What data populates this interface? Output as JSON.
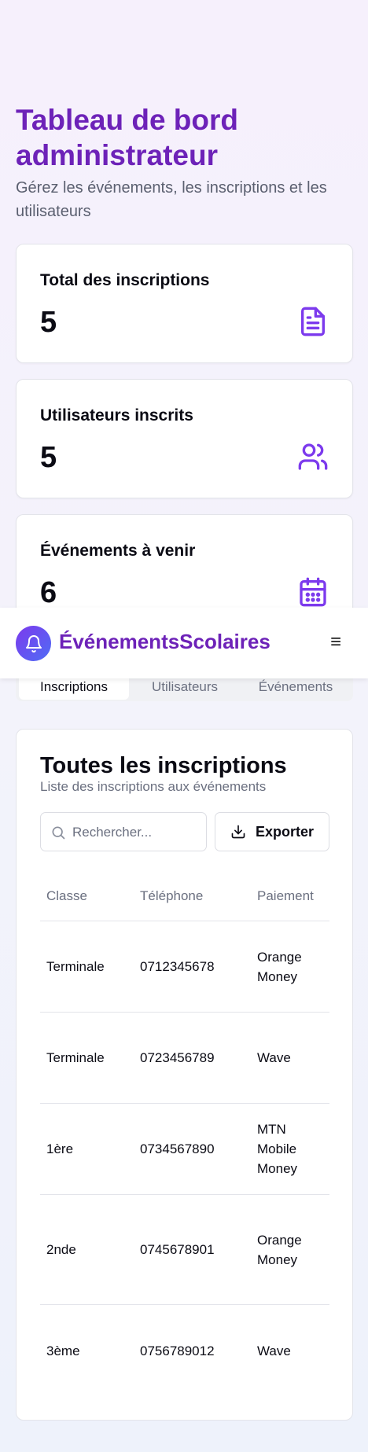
{
  "header": {
    "title": "Tableau de bord administrateur",
    "subtitle": "Gérez les événements, les inscriptions et les utilisateurs"
  },
  "stats": [
    {
      "label": "Total des inscriptions",
      "value": "5",
      "icon": "document-icon"
    },
    {
      "label": "Utilisateurs inscrits",
      "value": "5",
      "icon": "users-icon"
    },
    {
      "label": "Événements à venir",
      "value": "6",
      "icon": "calendar-icon"
    }
  ],
  "navbar": {
    "brand": "ÉvénementsScolaires",
    "logo_icon": "bell-icon",
    "menu_glyph": "≡"
  },
  "tabs": [
    {
      "label": "Inscriptions",
      "active": true
    },
    {
      "label": "Utilisateurs",
      "active": false
    },
    {
      "label": "Événements",
      "active": false
    }
  ],
  "inscriptions": {
    "title": "Toutes les inscriptions",
    "subtitle": "Liste des inscriptions aux événements",
    "search_placeholder": "Rechercher...",
    "export_label": "Exporter",
    "columns": [
      "Classe",
      "Téléphone",
      "Paiement"
    ],
    "rows": [
      {
        "classe": "Terminale",
        "telephone": "0712345678",
        "paiement": "Orange Money"
      },
      {
        "classe": "Terminale",
        "telephone": "0723456789",
        "paiement": "Wave"
      },
      {
        "classe": "1ère",
        "telephone": "0734567890",
        "paiement": "MTN Mobile Money"
      },
      {
        "classe": "2nde",
        "telephone": "0745678901",
        "paiement": "Orange Money"
      },
      {
        "classe": "3ème",
        "telephone": "0756789012",
        "paiement": "Wave"
      }
    ]
  },
  "colors": {
    "accent": "#6d22b8",
    "icon_purple": "#7c3aed",
    "logo_gradient_end": "#4f6df5"
  }
}
